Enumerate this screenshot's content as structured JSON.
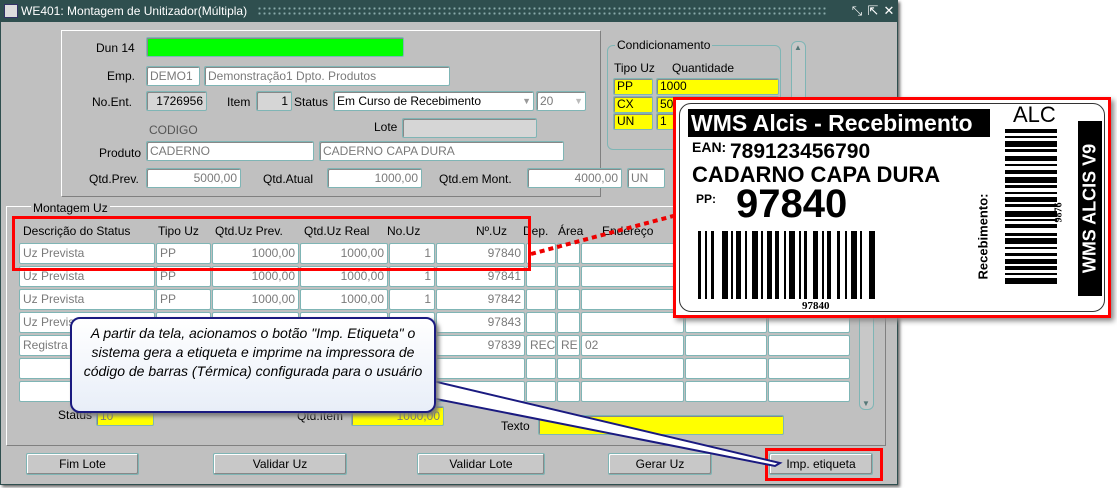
{
  "window": {
    "title": "WE401: Montagem de Unitizador(Múltipla)",
    "minimize_icon": "minimize-icon",
    "maximize_icon": "maximize-icon",
    "close_icon": "close-icon"
  },
  "header": {
    "dun14_label": "Dun 14",
    "dun14_value": "",
    "emp_label": "Emp.",
    "emp_code": "DEMO1",
    "emp_name": "Demonstração1 Dpto. Produtos",
    "noent_label": "No.Ent.",
    "noent_value": "1726956",
    "item_label": "Item",
    "item_value": "1",
    "status_label": "Status",
    "status_value": "Em Curso de Recebimento",
    "status_code": "20",
    "codigo_label": "CODIGO",
    "lote_label": "Lote",
    "lote_value": "",
    "produto_label": "Produto",
    "produto_code": "CADERNO",
    "produto_desc": "CADERNO CAPA DURA",
    "qtdprev_label": "Qtd.Prev.",
    "qtdprev_value": "5000,00",
    "qtdatual_label": "Qtd.Atual",
    "qtdatual_value": "1000,00",
    "qtdmont_label": "Qtd.em Mont.",
    "qtdmont_value": "4000,00",
    "unit_value": "UN"
  },
  "condicionamento": {
    "title": "Condicionamento",
    "col_tipo": "Tipo Uz",
    "col_qtd": "Quantidade",
    "rows": [
      {
        "tipo": "PP",
        "qtd": "1000"
      },
      {
        "tipo": "CX",
        "qtd": "50"
      },
      {
        "tipo": "UN",
        "qtd": "1"
      }
    ]
  },
  "montagem": {
    "title": "Montagem Uz",
    "columns": [
      "Descrição do Status",
      "Tipo Uz",
      "Qtd.Uz Prev.",
      "Qtd.Uz Real",
      "No.Uz",
      "Nº.Uz",
      "Dep.",
      "Área",
      "Endereço"
    ],
    "rows": [
      {
        "status": "Uz Prevista",
        "tipo": "PP",
        "prev": "1000,00",
        "real": "1000,00",
        "nouz": "1",
        "nuz": "97840",
        "dep": "",
        "area": "",
        "end": ""
      },
      {
        "status": "Uz Prevista",
        "tipo": "PP",
        "prev": "1000,00",
        "real": "1000,00",
        "nouz": "1",
        "nuz": "97841",
        "dep": "",
        "area": "",
        "end": ""
      },
      {
        "status": "Uz Prevista",
        "tipo": "PP",
        "prev": "1000,00",
        "real": "1000,00",
        "nouz": "1",
        "nuz": "97842",
        "dep": "",
        "area": "",
        "end": ""
      },
      {
        "status": "Uz Prevista",
        "tipo": "",
        "prev": "",
        "real": "",
        "nouz": "",
        "nuz": "97843",
        "dep": "",
        "area": "",
        "end": ""
      },
      {
        "status": "Registra",
        "tipo": "",
        "prev": "",
        "real": "",
        "nouz": "",
        "nuz": "97839",
        "dep": "REC",
        "area": "RE",
        "end": "02"
      },
      {
        "status": "",
        "tipo": "",
        "prev": "",
        "real": "",
        "nouz": "",
        "nuz": "",
        "dep": "",
        "area": "",
        "end": ""
      },
      {
        "status": "",
        "tipo": "",
        "prev": "",
        "real": "",
        "nouz": "",
        "nuz": "",
        "dep": "",
        "area": "",
        "end": ""
      }
    ],
    "status_label": "Status",
    "status_value": "10",
    "qtditem_label": "Qtd.Item",
    "qtditem_value": "1000,00",
    "texto_label": "Texto",
    "texto_value": ""
  },
  "buttons": {
    "fim_lote": "Fim Lote",
    "validar_uz": "Validar Uz",
    "validar_lote": "Validar Lote",
    "gerar_uz": "Gerar Uz",
    "imp_etiqueta": "Imp. etiqueta"
  },
  "callout": {
    "text": "A partir da tela, acionamos o botão \"Imp. Etiqueta\" o sistema gera a etiqueta e imprime na impressora de código de barras (Térmica) configurada para o usuário"
  },
  "label": {
    "title": "WMS Alcis - Recebimento",
    "ean_label": "EAN:",
    "ean_value": "789123456790",
    "product": "CADARNO CAPA DURA",
    "pp_label": "PP:",
    "pp_value": "97840",
    "barcode_text": "97840",
    "alc": "ALC",
    "recebimento": "Recebimento:",
    "side_code": "9876",
    "brand": "WMS ALCIS V9"
  },
  "colors": {
    "accent_red": "#ff0000",
    "highlight_yellow": "#ffff00",
    "dun_green": "#00ff00",
    "titlebar": "#2f4f4f"
  }
}
